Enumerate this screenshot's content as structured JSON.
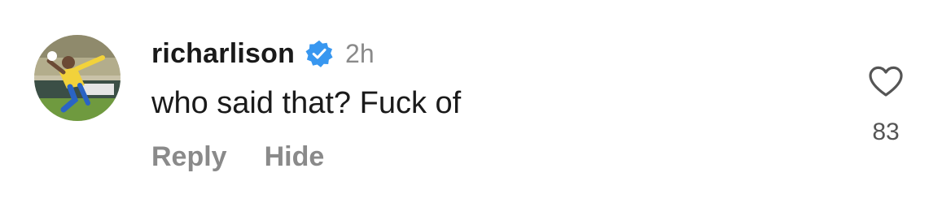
{
  "comment": {
    "username": "richarlison",
    "timestamp": "2h",
    "text": "who said that? Fuck of",
    "verified": true,
    "avatar_icon": "profile-photo-icon",
    "verified_icon": "verified-badge-icon",
    "verified_color": "#3897f0"
  },
  "actions": {
    "reply_label": "Reply",
    "hide_label": "Hide"
  },
  "likes": {
    "count": "83",
    "icon": "heart-outline-icon"
  }
}
